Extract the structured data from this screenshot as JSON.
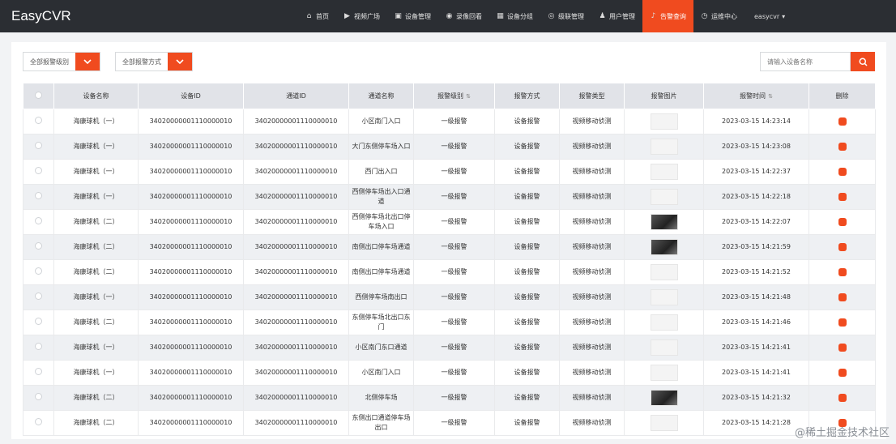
{
  "app": {
    "title": "EasyCVR"
  },
  "nav": [
    {
      "label": "首页",
      "icon": "home-icon",
      "glyph": "⌂"
    },
    {
      "label": "视频广场",
      "icon": "play-circle-icon",
      "glyph": "▶"
    },
    {
      "label": "设备管理",
      "icon": "device-icon",
      "glyph": "▣"
    },
    {
      "label": "录像回看",
      "icon": "camera-icon",
      "glyph": "◉"
    },
    {
      "label": "设备分组",
      "icon": "grid-icon",
      "glyph": "▦"
    },
    {
      "label": "级联管理",
      "icon": "link-icon",
      "glyph": "◎"
    },
    {
      "label": "用户管理",
      "icon": "user-icon",
      "glyph": "♟"
    },
    {
      "label": "告警查询",
      "icon": "bell-icon",
      "glyph": "♪",
      "active": true
    },
    {
      "label": "运维中心",
      "icon": "clock-icon",
      "glyph": "◷"
    }
  ],
  "user": {
    "name": "easycvr"
  },
  "filters": {
    "level": {
      "value": "全部报警级别"
    },
    "method": {
      "value": "全部报警方式"
    }
  },
  "search": {
    "placeholder": "请输入设备名称"
  },
  "columns": [
    "",
    "设备名称",
    "设备ID",
    "通道ID",
    "通道名称",
    "报警级别",
    "报警方式",
    "报警类型",
    "报警图片",
    "报警时间",
    "删除"
  ],
  "rows": [
    {
      "device": "海康球机（一）",
      "device_id": "34020000001110000010",
      "channel_id": "34020000001110000010",
      "channel": "小区南门入口",
      "level": "一级报警",
      "method": "设备报警",
      "type": "视频移动侦测",
      "thumb": "light",
      "time": "2023-03-15 14:23:14"
    },
    {
      "device": "海康球机（一）",
      "device_id": "34020000001110000010",
      "channel_id": "34020000001110000010",
      "channel": "大门东侧停车场入口",
      "level": "一级报警",
      "method": "设备报警",
      "type": "视频移动侦测",
      "thumb": "light",
      "time": "2023-03-15 14:23:08"
    },
    {
      "device": "海康球机（一）",
      "device_id": "34020000001110000010",
      "channel_id": "34020000001110000010",
      "channel": "西门出入口",
      "level": "一级报警",
      "method": "设备报警",
      "type": "视频移动侦测",
      "thumb": "light",
      "time": "2023-03-15 14:22:37"
    },
    {
      "device": "海康球机（一）",
      "device_id": "34020000001110000010",
      "channel_id": "34020000001110000010",
      "channel": "西侧停车场出入口通道",
      "level": "一级报警",
      "method": "设备报警",
      "type": "视频移动侦测",
      "thumb": "light",
      "time": "2023-03-15 14:22:18"
    },
    {
      "device": "海康球机（二）",
      "device_id": "34020000001110000010",
      "channel_id": "34020000001110000010",
      "channel": "西侧停车场北出口停车场入口",
      "level": "一级报警",
      "method": "设备报警",
      "type": "视频移动侦测",
      "thumb": "dark",
      "time": "2023-03-15 14:22:07"
    },
    {
      "device": "海康球机（二）",
      "device_id": "34020000001110000010",
      "channel_id": "34020000001110000010",
      "channel": "南侧出口停车场通道",
      "level": "一级报警",
      "method": "设备报警",
      "type": "视频移动侦测",
      "thumb": "dark",
      "time": "2023-03-15 14:21:59"
    },
    {
      "device": "海康球机（二）",
      "device_id": "34020000001110000010",
      "channel_id": "34020000001110000010",
      "channel": "南侧出口停车场通道",
      "level": "一级报警",
      "method": "设备报警",
      "type": "视频移动侦测",
      "thumb": "light",
      "time": "2023-03-15 14:21:52"
    },
    {
      "device": "海康球机（一）",
      "device_id": "34020000001110000010",
      "channel_id": "34020000001110000010",
      "channel": "西侧停车场南出口",
      "level": "一级报警",
      "method": "设备报警",
      "type": "视频移动侦测",
      "thumb": "light",
      "time": "2023-03-15 14:21:48"
    },
    {
      "device": "海康球机（二）",
      "device_id": "34020000001110000010",
      "channel_id": "34020000001110000010",
      "channel": "东侧停车场北出口东门",
      "level": "一级报警",
      "method": "设备报警",
      "type": "视频移动侦测",
      "thumb": "light",
      "time": "2023-03-15 14:21:46"
    },
    {
      "device": "海康球机（一）",
      "device_id": "34020000001110000010",
      "channel_id": "34020000001110000010",
      "channel": "小区南门东口通道",
      "level": "一级报警",
      "method": "设备报警",
      "type": "视频移动侦测",
      "thumb": "light",
      "time": "2023-03-15 14:21:41"
    },
    {
      "device": "海康球机（一）",
      "device_id": "34020000001110000010",
      "channel_id": "34020000001110000010",
      "channel": "小区南门入口",
      "level": "一级报警",
      "method": "设备报警",
      "type": "视频移动侦测",
      "thumb": "light",
      "time": "2023-03-15 14:21:41"
    },
    {
      "device": "海康球机（二）",
      "device_id": "34020000001110000010",
      "channel_id": "34020000001110000010",
      "channel": "北侧停车场",
      "level": "一级报警",
      "method": "设备报警",
      "type": "视频移动侦测",
      "thumb": "dark",
      "time": "2023-03-15 14:21:32"
    },
    {
      "device": "海康球机（二）",
      "device_id": "34020000001110000010",
      "channel_id": "34020000001110000010",
      "channel": "东侧出口通道停车场出口",
      "level": "一级报警",
      "method": "设备报警",
      "type": "视频移动侦测",
      "thumb": "light",
      "time": "2023-03-15 14:21:28"
    }
  ],
  "watermark": "@稀土掘金技术社区",
  "colors": {
    "accent": "#f04b1f",
    "topbar": "#2b2e33"
  }
}
